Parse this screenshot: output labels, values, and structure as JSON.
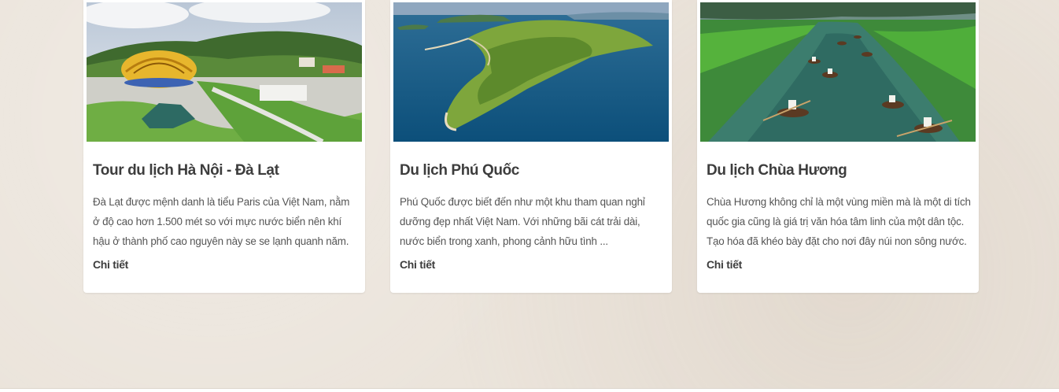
{
  "cards": [
    {
      "title": "Tour du lịch Hà Nội - Đà Lạt",
      "description": "Đà Lạt được mệnh danh là tiểu Paris của Việt Nam, nằm ở độ cao hơn 1.500 mét so với mực nước biển nên khí hậu ở thành phố cao nguyên này se se lạnh quanh năm.",
      "link_label": "Chi tiết",
      "image": "da-lat-flower-dome-photo"
    },
    {
      "title": "Du lịch Phú Quốc",
      "description": "Phú Quốc được biết đến như một khu tham quan nghỉ dưỡng đẹp nhất Việt Nam. Với những bãi cát trải dài, nước biển trong xanh, phong cảnh hữu tình ...",
      "link_label": "Chi tiết",
      "image": "phu-quoc-island-photo"
    },
    {
      "title": "Du lịch Chùa Hương",
      "description": "Chùa Hương không chỉ là một vùng miền mà là một di tích quốc gia cũng là giá trị văn hóa tâm linh của một dân tộc. Tạo hóa đã khéo bày đặt cho nơi đây núi non sông nước.",
      "link_label": "Chi tiết",
      "image": "chua-huong-river-boats-photo"
    }
  ]
}
